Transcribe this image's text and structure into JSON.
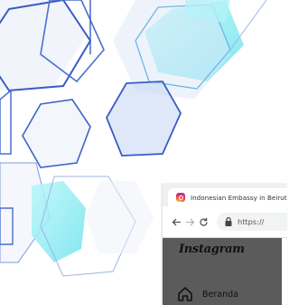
{
  "browser": {
    "tab": {
      "title": "Indonesian Embassy in Beirut",
      "favicon": "instagram-icon"
    },
    "toolbar": {
      "back_icon": "arrow-left-icon",
      "forward_icon": "arrow-right-icon",
      "reload_icon": "reload-icon",
      "lock_icon": "lock-icon",
      "url": "https://"
    }
  },
  "instagram": {
    "logo": "Instagram",
    "nav": [
      {
        "label": "Beranda",
        "icon": "home-icon"
      }
    ]
  },
  "colors": {
    "hexagon_blue": "#3b5fc0",
    "hexagon_cyan": "#7fe9f0",
    "sidebar_bg": "#5b5b5b"
  }
}
